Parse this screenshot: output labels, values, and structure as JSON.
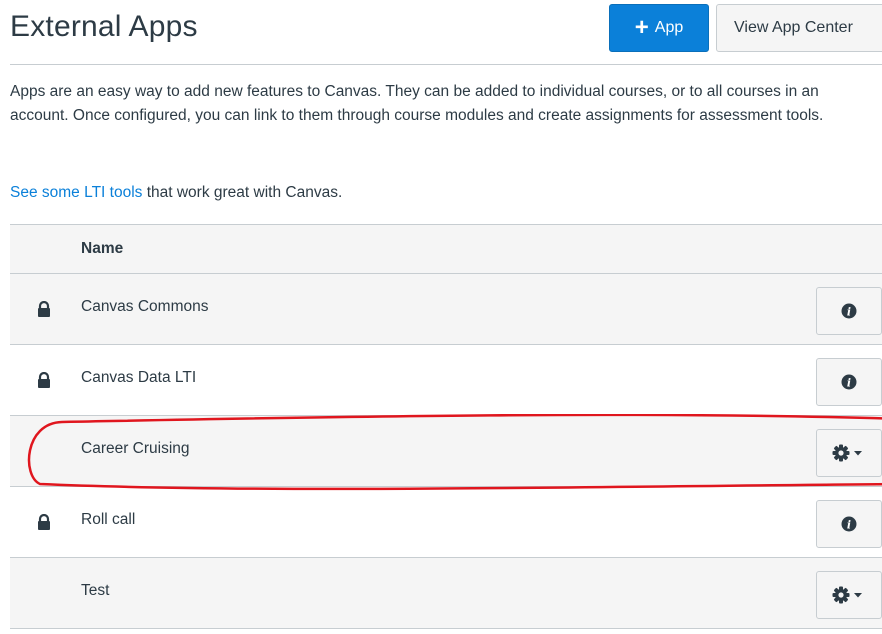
{
  "header": {
    "title": "External Apps",
    "add_button": {
      "icon": "plus-icon",
      "label": "App"
    },
    "app_center_label": "View App Center"
  },
  "description": "Apps are an easy way to add new features to Canvas. They can be added to individual courses, or to all courses in an account. Once configured, you can link to them through course modules and create assignments for assessment tools.",
  "lti_line": {
    "link_text": "See some LTI tools",
    "rest": " that work great with Canvas."
  },
  "table": {
    "column_header": "Name",
    "rows": [
      {
        "name": "Canvas Commons",
        "locked": true,
        "action": "info"
      },
      {
        "name": "Canvas Data LTI",
        "locked": true,
        "action": "info"
      },
      {
        "name": "Career Cruising",
        "locked": false,
        "action": "settings"
      },
      {
        "name": "Roll call",
        "locked": true,
        "action": "info"
      },
      {
        "name": "Test",
        "locked": false,
        "action": "settings"
      }
    ]
  },
  "colors": {
    "primary": "#0b80d9",
    "text": "#2d3b45",
    "annotation": "#e0161e"
  }
}
